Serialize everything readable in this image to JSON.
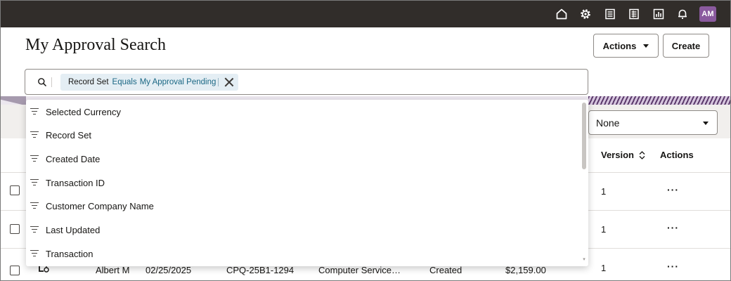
{
  "topbar": {
    "icons": [
      "home-icon",
      "settings-icon",
      "list-icon",
      "list-detail-icon",
      "bar-chart-icon",
      "bell-icon"
    ],
    "avatar_initials": "AM",
    "avatar_color": "#8a5a9e"
  },
  "header": {
    "title": "My Approval Search",
    "actions_label": "Actions",
    "create_label": "Create"
  },
  "search": {
    "chip": {
      "key": "Record Set",
      "operator": "Equals",
      "value": "My Approval Pending"
    }
  },
  "filter_menu": {
    "items": [
      "Selected Currency",
      "Record Set",
      "Created Date",
      "Transaction ID",
      "Customer Company Name",
      "Last Updated",
      "Transaction"
    ]
  },
  "sort_select": {
    "value": "None"
  },
  "table": {
    "headers": {
      "version": "Version",
      "actions": "Actions"
    },
    "rows": [
      {
        "version": "1",
        "actions": "···"
      },
      {
        "version": "1",
        "actions": "···"
      },
      {
        "owner": "Albert M",
        "date": "02/25/2025",
        "transaction_id": "CPQ-25B1-1294",
        "customer": "Computer Service…",
        "status": "Created",
        "amount": "$2,159.00",
        "version": "1",
        "actions": "···"
      }
    ]
  },
  "colors": {
    "topbar": "#312d2a",
    "chip_bg": "#e4eef4",
    "chip_text": "#1a6784",
    "toolbar_bg": "#f1efed"
  }
}
